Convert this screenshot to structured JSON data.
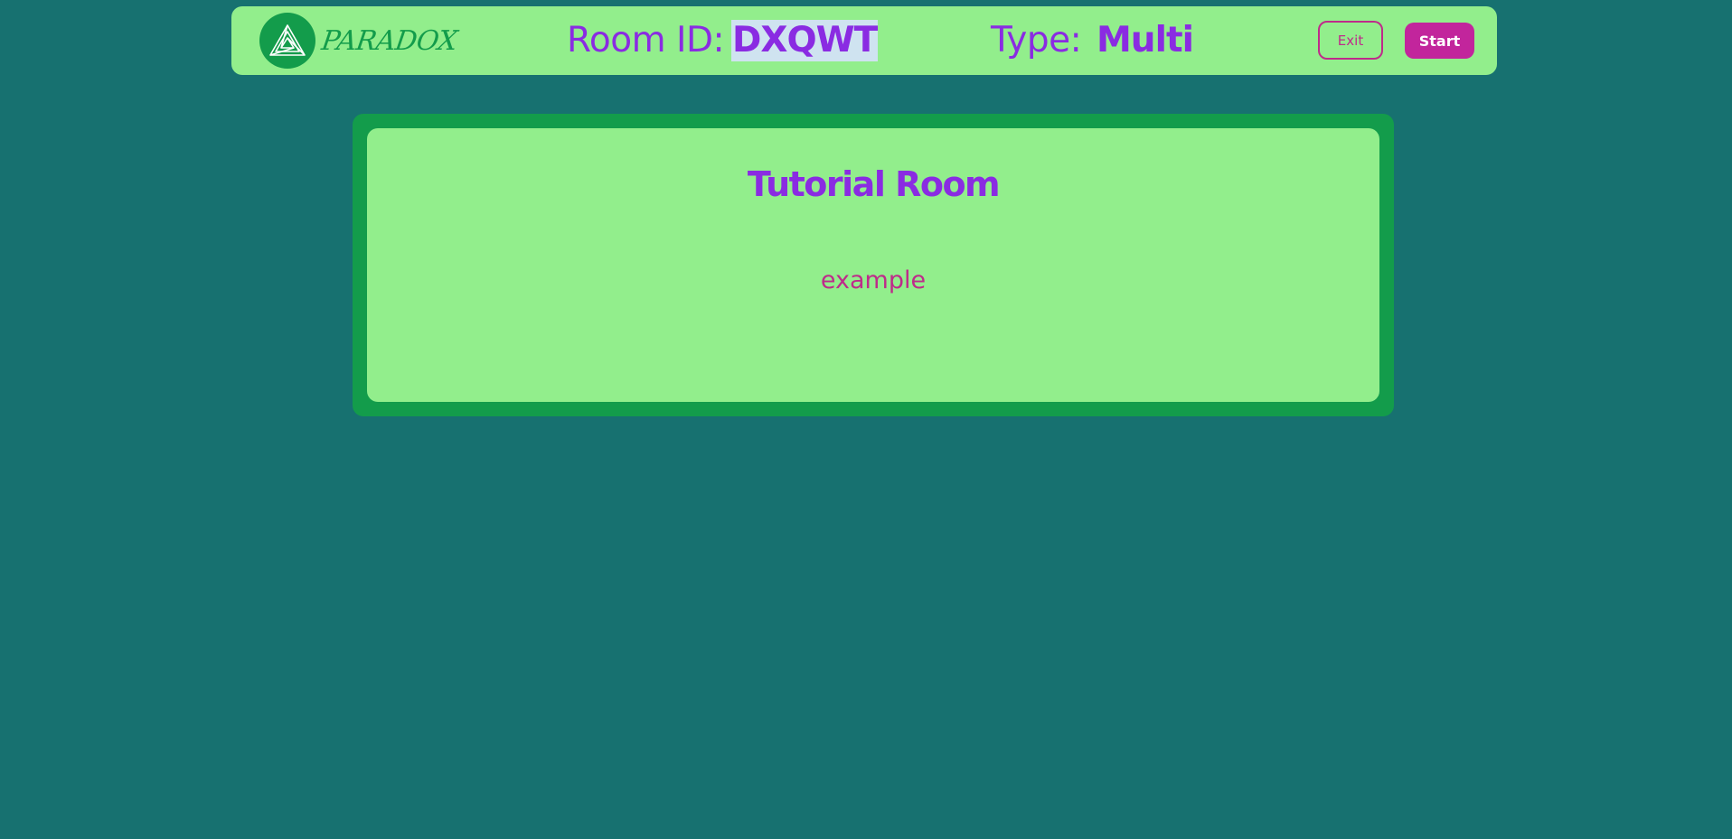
{
  "header": {
    "logo_text": "PARADOX",
    "logo_icon": "penrose-triangle-icon",
    "room_id_label": "Room ID:",
    "room_id_value": "DXQWT",
    "type_label": "Type:",
    "type_value": "Multi",
    "exit_label": "Exit",
    "start_label": "Start"
  },
  "room": {
    "title": "Tutorial Room",
    "description": "example"
  },
  "colors": {
    "background": "#177170",
    "panel": "#92ee8c",
    "brand_green": "#139c4b",
    "accent_purple": "#8a2be2",
    "accent_magenta": "#bf2a8a",
    "selection_highlight": "#cfe3f0"
  }
}
